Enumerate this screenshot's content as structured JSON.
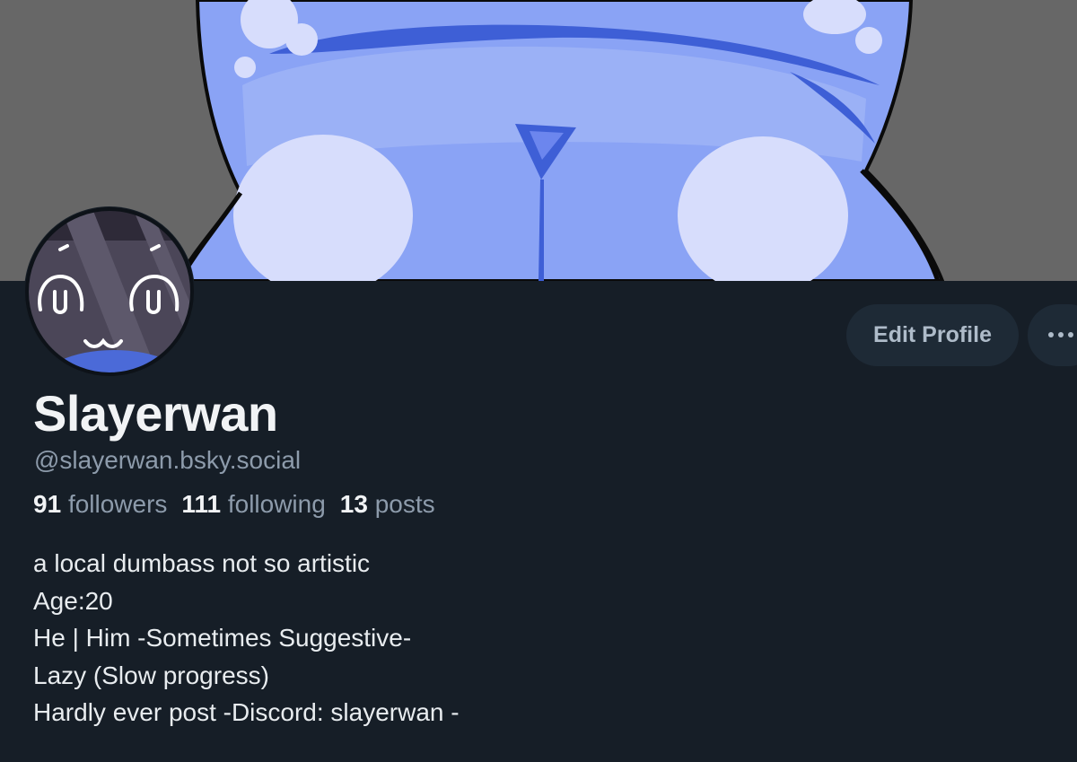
{
  "profile": {
    "display_name": "Slayerwan",
    "handle": "@slayerwan.bsky.social",
    "stats": {
      "followers_count": "91",
      "followers_label": "followers",
      "following_count": "111",
      "following_label": "following",
      "posts_count": "13",
      "posts_label": "posts"
    },
    "bio_lines": [
      "a local dumbass not so artistic",
      "Age:20",
      "He | Him -Sometimes Suggestive-",
      "Lazy (Slow progress)",
      "Hardly ever post -Discord: slayerwan -"
    ]
  },
  "actions": {
    "edit_profile_label": "Edit Profile",
    "more_icon": "ellipsis-icon"
  },
  "colors": {
    "background": "#161e27",
    "banner_gray": "#676767",
    "banner_blue": "#8aa3f5",
    "button_bg": "#1e2a36",
    "secondary_text": "#8d9bab"
  }
}
